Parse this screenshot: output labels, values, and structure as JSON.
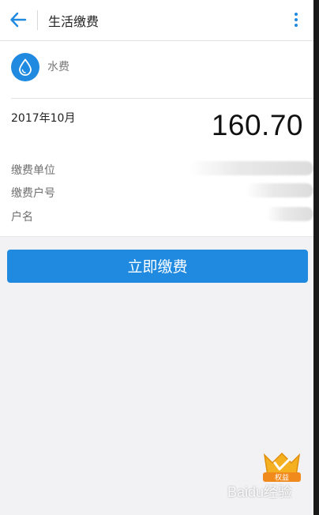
{
  "header": {
    "title": "生活缴费"
  },
  "service": {
    "name": "水费",
    "icon": "water-drop-icon"
  },
  "bill": {
    "period": "2017年10月",
    "amount": "160.70",
    "fields": [
      {
        "label": "缴费单位"
      },
      {
        "label": "缴费户号"
      },
      {
        "label": "户名"
      }
    ]
  },
  "actions": {
    "pay_label": "立即缴费"
  },
  "watermark": {
    "badge_text": "权益",
    "brand_text": "Baidu经验"
  },
  "colors": {
    "accent": "#1f8ae0",
    "background": "#f2f2f4"
  }
}
